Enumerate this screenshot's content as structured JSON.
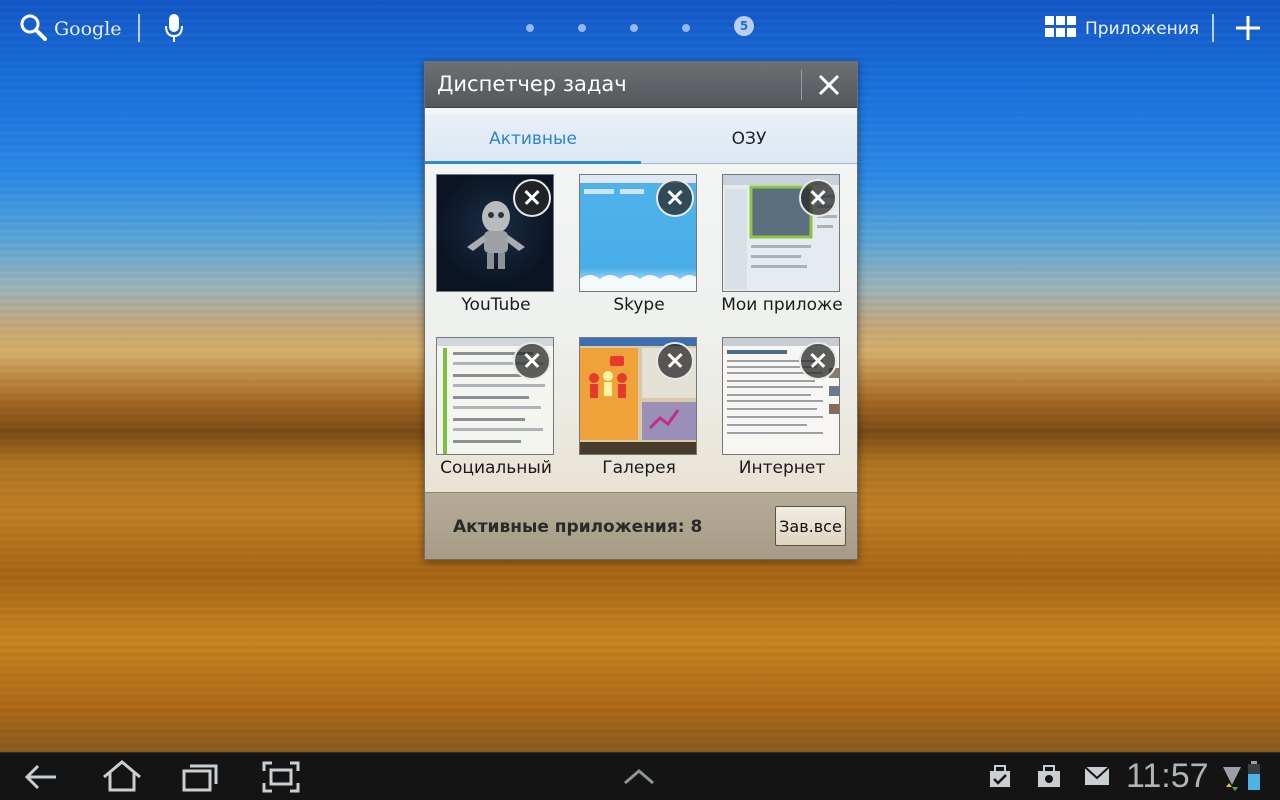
{
  "topbar": {
    "search_label": "Google",
    "current_page": "5",
    "apps_label": "Приложения"
  },
  "dialog": {
    "title": "Диспетчер задач",
    "tabs": [
      {
        "label": "Активные",
        "active": true
      },
      {
        "label": "ОЗУ",
        "active": false
      }
    ],
    "apps": [
      {
        "label": "YouTube"
      },
      {
        "label": "Skype"
      },
      {
        "label": "Мои приложе"
      },
      {
        "label": "Социальный"
      },
      {
        "label": "Галерея"
      },
      {
        "label": "Интернет"
      }
    ],
    "footer_text": "Активные приложения: 8",
    "close_all_label": "Зав.все"
  },
  "system_bar": {
    "time": "11:57"
  },
  "colors": {
    "tab_active": "#2a86c8",
    "dialog_header": "#5e6164",
    "system_bar": "#141414"
  }
}
